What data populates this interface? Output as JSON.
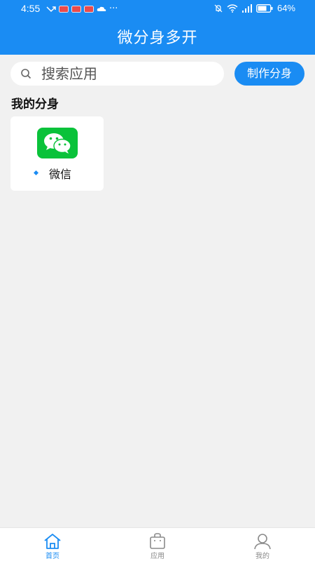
{
  "status_bar": {
    "time": "4:55",
    "more": "···",
    "battery": "64%",
    "notif_icons": [
      "missed-call-icon",
      "app-notification-icon",
      "app-notification-icon",
      "app-notification-icon",
      "cloud-icon"
    ],
    "system_icons": [
      "mute-icon",
      "wifi-icon",
      "signal-icon",
      "battery-icon"
    ]
  },
  "header": {
    "title": "微分身多开"
  },
  "search": {
    "placeholder": "搜索应用"
  },
  "make_button": {
    "label": "制作分身"
  },
  "section": {
    "title": "我的分身"
  },
  "apps": [
    {
      "label": "微信",
      "icon": "wechat-icon"
    }
  ],
  "nav": {
    "items": [
      {
        "label": "首页",
        "icon": "home-icon",
        "active": true
      },
      {
        "label": "应用",
        "icon": "shopping-bag-icon",
        "active": false
      },
      {
        "label": "我的",
        "icon": "user-icon",
        "active": false
      }
    ]
  },
  "colors": {
    "primary": "#1a8cf3",
    "background": "#f1f1f1",
    "wechat_green": "#0ac23a",
    "nav_inactive": "#8a8a8a"
  }
}
